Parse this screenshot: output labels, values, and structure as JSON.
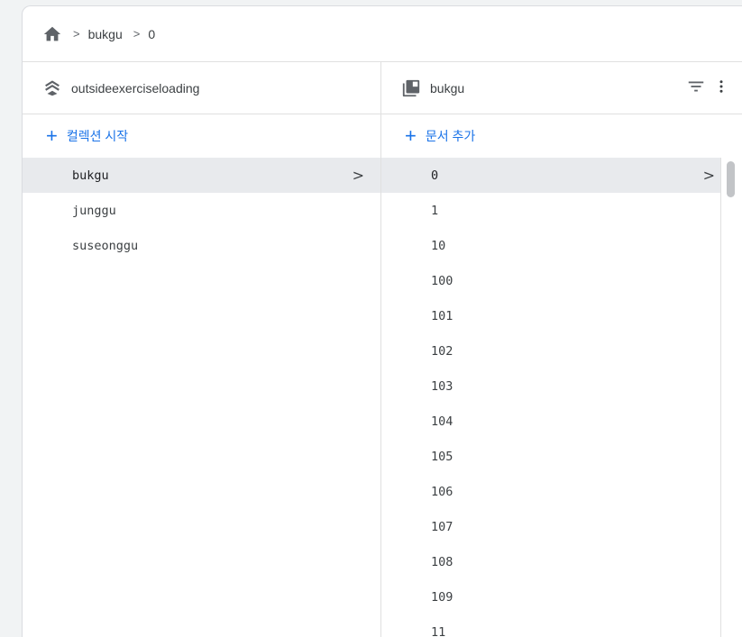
{
  "breadcrumb": {
    "icon": "home-icon",
    "items": [
      "bukgu",
      "0"
    ],
    "separator": ">"
  },
  "left": {
    "header_title": "outsideexerciseloading",
    "header_icon": "firestore-stack-icon",
    "add_label": "컬렉션 시작",
    "items": [
      {
        "label": "bukgu",
        "selected": true
      },
      {
        "label": "junggu",
        "selected": false
      },
      {
        "label": "suseonggu",
        "selected": false
      }
    ]
  },
  "right": {
    "header_title": "bukgu",
    "header_icon": "collection-icon",
    "add_label": "문서 추가",
    "items": [
      {
        "label": "0",
        "selected": true
      },
      {
        "label": "1"
      },
      {
        "label": "10"
      },
      {
        "label": "100"
      },
      {
        "label": "101"
      },
      {
        "label": "102"
      },
      {
        "label": "103"
      },
      {
        "label": "104"
      },
      {
        "label": "105"
      },
      {
        "label": "106"
      },
      {
        "label": "107"
      },
      {
        "label": "108"
      },
      {
        "label": "109"
      },
      {
        "label": "11"
      }
    ]
  },
  "colors": {
    "accent": "#1a73e8",
    "selected_bg": "#e8eaed"
  }
}
